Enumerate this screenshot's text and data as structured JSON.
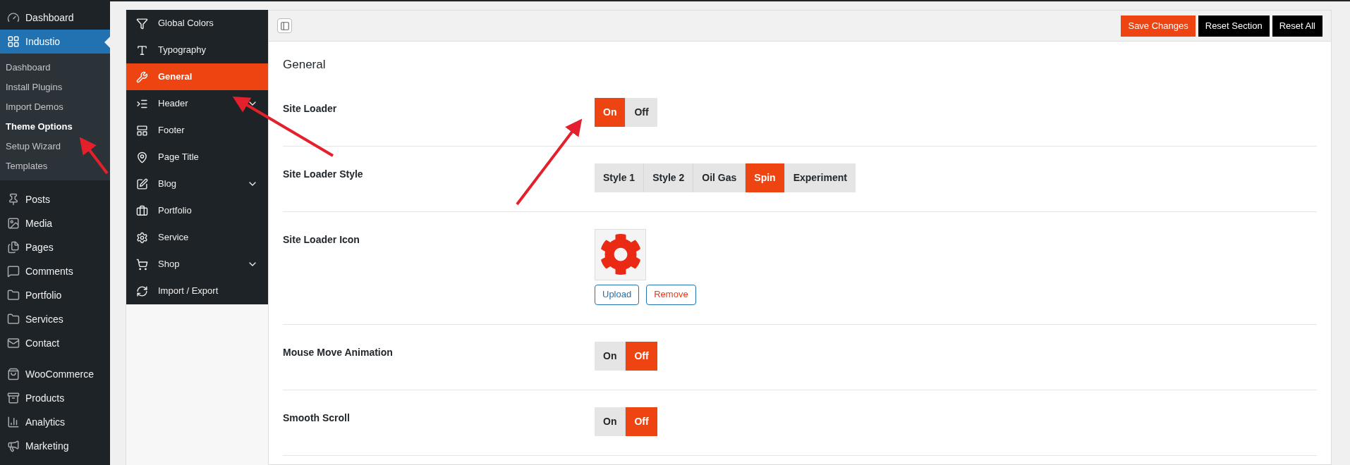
{
  "wp_menu": {
    "top": [
      {
        "label": "Dashboard",
        "selected": false
      }
    ],
    "current": {
      "label": "Industio",
      "selected": true,
      "children": [
        {
          "label": "Dashboard",
          "selected": false
        },
        {
          "label": "Install Plugins",
          "selected": false
        },
        {
          "label": "Import Demos",
          "selected": false
        },
        {
          "label": "Theme Options",
          "selected": true
        },
        {
          "label": "Setup Wizard",
          "selected": false
        },
        {
          "label": "Templates",
          "selected": false
        }
      ]
    },
    "groups": [
      [
        {
          "label": "Posts"
        },
        {
          "label": "Media"
        },
        {
          "label": "Pages"
        },
        {
          "label": "Comments"
        },
        {
          "label": "Portfolio"
        },
        {
          "label": "Services"
        },
        {
          "label": "Contact"
        }
      ],
      [
        {
          "label": "WooCommerce"
        },
        {
          "label": "Products"
        },
        {
          "label": "Analytics"
        },
        {
          "label": "Marketing"
        }
      ]
    ]
  },
  "options_menu": [
    {
      "label": "Global Colors",
      "selected": false,
      "expandable": false
    },
    {
      "label": "Typography",
      "selected": false,
      "expandable": false
    },
    {
      "label": "General",
      "selected": true,
      "expandable": false
    },
    {
      "label": "Header",
      "selected": false,
      "expandable": true
    },
    {
      "label": "Footer",
      "selected": false,
      "expandable": false
    },
    {
      "label": "Page Title",
      "selected": false,
      "expandable": false
    },
    {
      "label": "Blog",
      "selected": false,
      "expandable": true
    },
    {
      "label": "Portfolio",
      "selected": false,
      "expandable": false
    },
    {
      "label": "Service",
      "selected": false,
      "expandable": false
    },
    {
      "label": "Shop",
      "selected": false,
      "expandable": true
    },
    {
      "label": "Import / Export",
      "selected": false,
      "expandable": false
    }
  ],
  "toolbar": {
    "buttons": [
      {
        "label": "Save Changes",
        "kind": "primary"
      },
      {
        "label": "Reset Section",
        "kind": "dark"
      },
      {
        "label": "Reset All",
        "kind": "dark"
      }
    ]
  },
  "section_title": "General",
  "fields": [
    {
      "label": "Site Loader",
      "kind": "buttonset",
      "options": [
        {
          "label": "On",
          "selected": true
        },
        {
          "label": "Off",
          "selected": false
        }
      ]
    },
    {
      "label": "Site Loader Style",
      "kind": "buttonset",
      "options": [
        {
          "label": "Style 1",
          "selected": false
        },
        {
          "label": "Style 2",
          "selected": false
        },
        {
          "label": "Oil Gas",
          "selected": false
        },
        {
          "label": "Spin",
          "selected": true
        },
        {
          "label": "Experiment",
          "selected": false
        }
      ]
    },
    {
      "label": "Site Loader Icon",
      "kind": "media",
      "upload": "Upload",
      "remove": "Remove"
    },
    {
      "label": "Mouse Move Animation",
      "kind": "buttonset",
      "options": [
        {
          "label": "On",
          "selected": false
        },
        {
          "label": "Off",
          "selected": true
        }
      ]
    },
    {
      "label": "Smooth Scroll",
      "kind": "buttonset",
      "options": [
        {
          "label": "On",
          "selected": false
        },
        {
          "label": "Off",
          "selected": true
        }
      ]
    }
  ]
}
